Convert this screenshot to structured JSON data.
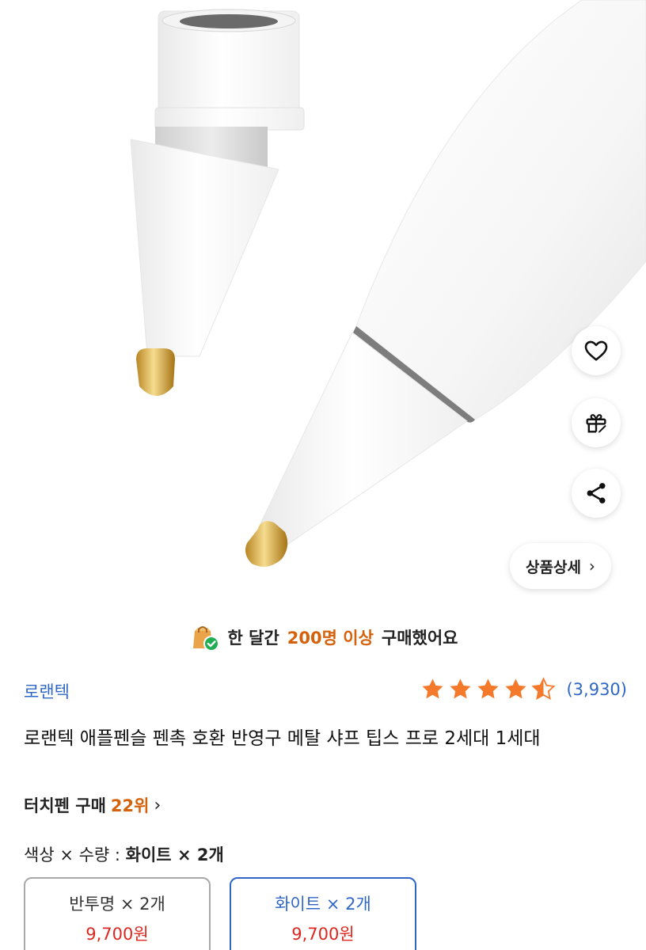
{
  "actions": {
    "like_icon": "heart-icon",
    "gift_icon": "gift-icon",
    "share_icon": "share-icon",
    "detail_label": "상품상세",
    "detail_chevron": "›"
  },
  "banner": {
    "prefix": "한 달간",
    "highlight": "200명 이상",
    "suffix": "구매했어요"
  },
  "product": {
    "brand": "로랜텍",
    "rating": 4.5,
    "review_count": "(3,930)",
    "title": "로랜텍 애플펜슬 펜촉 호환 반영구 메탈 샤프 팁스 프로 2세대 1세대",
    "rank_prefix": "터치펜 구매",
    "rank_value": "22위",
    "rank_chevron": "›"
  },
  "options": {
    "label": "색상 × 수량 :",
    "selected": "화이트 × 2개",
    "items": [
      {
        "name": "반투명 × 2개",
        "price": "9,700원",
        "selected": false
      },
      {
        "name": "화이트 × 2개",
        "price": "9,700원",
        "selected": true
      }
    ]
  },
  "colors": {
    "accent_orange": "#d5610a",
    "link_blue": "#2f67c6",
    "price_red": "#e0261f",
    "star": "#f5792b"
  }
}
